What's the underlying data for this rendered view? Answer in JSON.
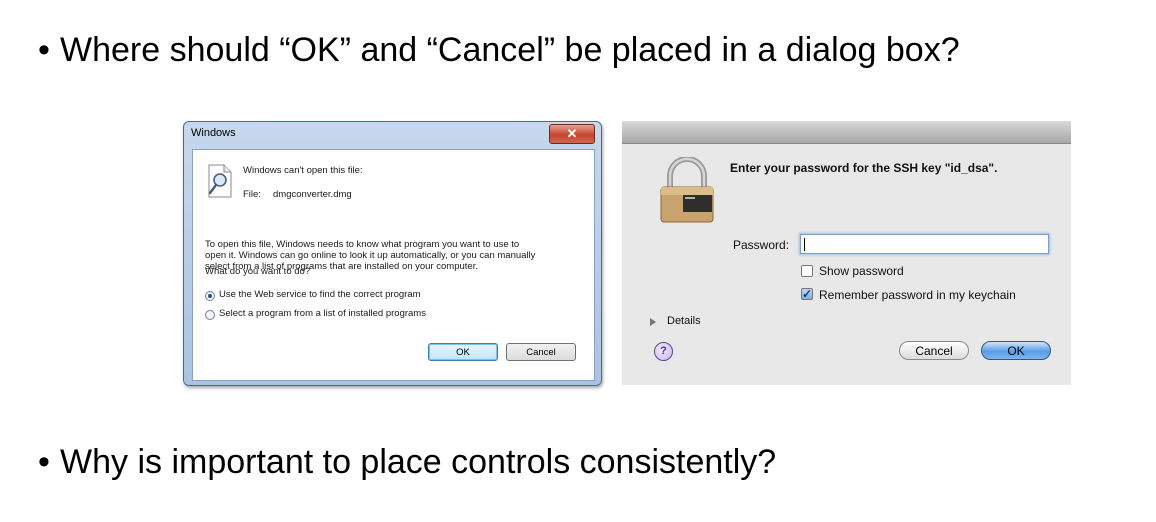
{
  "bullets": {
    "q1": "Where should “OK” and “Cancel” be placed in a dialog box?",
    "q2": "Why is important to place controls consistently?"
  },
  "windows_dialog": {
    "title": "Windows",
    "close_glyph": "✕",
    "message": "Windows can't open this file:",
    "file_label": "File:",
    "file_name": "dmgconverter.dmg",
    "paragraph": [
      "To open this file, Windows needs to know what program you want to use to",
      "open it. Windows can go online to look it up automatically, or you can manually",
      "select from a list of programs that are installed on your computer."
    ],
    "question": "What do you want to do?",
    "options": [
      {
        "label": "Use the Web service to find the correct program",
        "selected": true
      },
      {
        "label": "Select a program from a list of installed programs",
        "selected": false
      }
    ],
    "ok_label": "OK",
    "cancel_label": "Cancel",
    "icon": "magnifier-document-icon"
  },
  "mac_dialog": {
    "heading": "Enter your password for the SSH key \"id_dsa\".",
    "password_label": "Password:",
    "password_value": "",
    "show_password_label": "Show password",
    "show_password_checked": false,
    "remember_label": "Remember password in my keychain",
    "remember_checked": true,
    "details_label": "Details",
    "help_glyph": "?",
    "cancel_label": "Cancel",
    "ok_label": "OK",
    "icon": "padlock-icon"
  }
}
